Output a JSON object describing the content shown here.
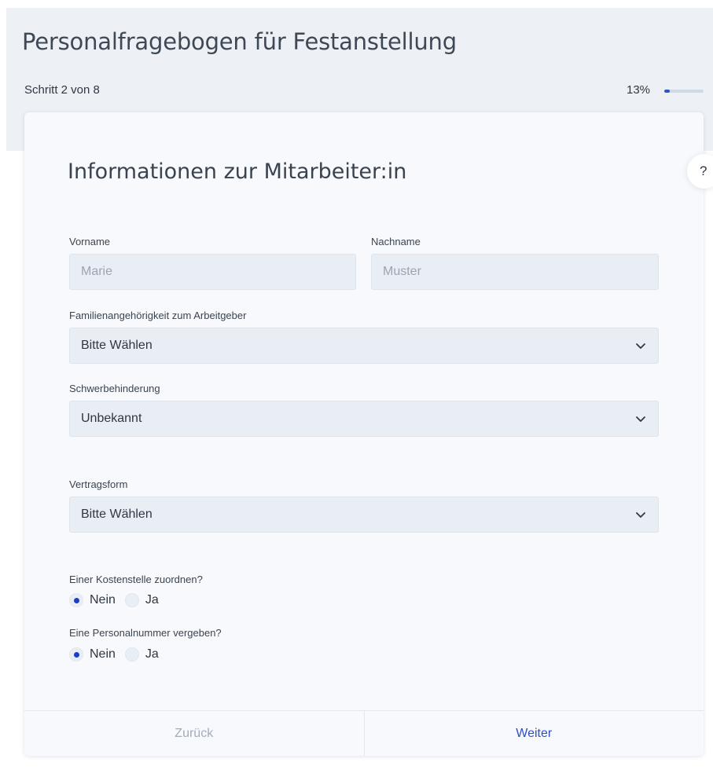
{
  "header": {
    "title": "Personalfragebogen für Festanstellung",
    "step": "Schritt 2 von 8",
    "progress_text": "13%",
    "progress_fraction": 0.13
  },
  "help": {
    "label": "?",
    "icon": "help-icon"
  },
  "form": {
    "title": "Informationen zur Mitarbeiter:in",
    "first_name": {
      "label": "Vorname",
      "placeholder": "Marie",
      "value": ""
    },
    "last_name": {
      "label": "Nachname",
      "placeholder": "Muster",
      "value": ""
    },
    "family_relation": {
      "label": "Familienangehörigkeit zum Arbeitgeber",
      "selected": "Bitte Wählen"
    },
    "disability": {
      "label": "Schwerbehinderung",
      "selected": "Unbekannt"
    },
    "contract_type": {
      "label": "Vertragsform",
      "selected": "Bitte Wählen"
    },
    "cost_center": {
      "label": "Einer Kostenstelle zuordnen?",
      "options": [
        "Nein",
        "Ja"
      ],
      "selected": "Nein"
    },
    "personnel_number": {
      "label": "Eine Personalnummer vergeben?",
      "options": [
        "Nein",
        "Ja"
      ],
      "selected": "Nein"
    }
  },
  "footer": {
    "back_label": "Zurück",
    "next_label": "Weiter"
  },
  "colors": {
    "accent": "#2d4fc8",
    "radio_checked": "#1b3fc4",
    "field_bg": "#e9eef5"
  }
}
